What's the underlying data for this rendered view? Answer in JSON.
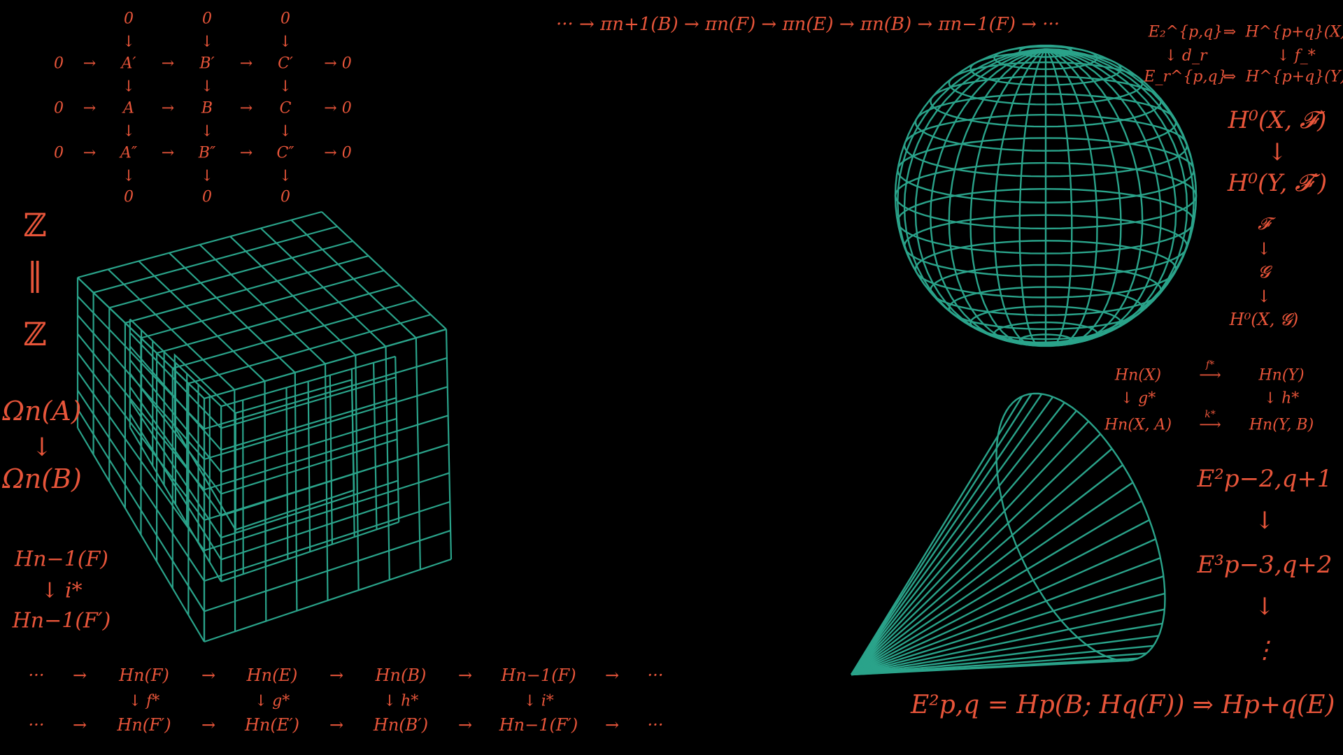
{
  "colors": {
    "background": "#000000",
    "formula": "#e8553a",
    "wireframe": "#2aa38a"
  },
  "nine_lemma": {
    "rows": [
      [
        "",
        "0",
        "",
        "0",
        "",
        "0",
        "",
        ""
      ],
      [
        "0",
        "→",
        "A′",
        "→",
        "B′",
        "→",
        "C′",
        "→ 0"
      ],
      [
        "0",
        "→",
        "A",
        "→",
        "B",
        "→",
        "C",
        "→ 0"
      ],
      [
        "0",
        "→",
        "A″",
        "→",
        "B″",
        "→",
        "C″",
        "→ 0"
      ],
      [
        "",
        "0",
        "",
        "0",
        "",
        "0",
        "",
        ""
      ]
    ],
    "top_zero": "0",
    "bottom_zero": "0",
    "arrow_down": "↓"
  },
  "top_sequence": "⋯ → π_{n+1}(B) → π_n(F) → π_n(E) → π_n(B) → π_{n−1}(F) → ⋯",
  "top_sequence_display": "··· → πn+1(B) → πn(F) → πn(E) → πn(B) → πn−1(F) → ···",
  "spectral_top_right": {
    "row1_left": "E₂^{p,q}",
    "row1_arrow": "⇒",
    "row1_right": "H^{p+q}(X)",
    "row2_left": "↓ d_r",
    "row2_right": "↓ f_*",
    "row3_left": "E_r^{p,q}",
    "row3_arrow": "⇒",
    "row3_right": "H^{p+q}(Y)"
  },
  "sheaf_cohomology": {
    "top": "H⁰(X, 𝓕)",
    "arrow": "↓",
    "bottom": "H⁰(Y, 𝓕′)"
  },
  "sheaf_map": {
    "top": "𝓕",
    "arrow1": "↓",
    "middle": "𝓖",
    "arrow2": "↓",
    "bottom": "H⁰(X, 𝓖)"
  },
  "homology_square": {
    "tl": "Hn(X)",
    "top_arrow": "f*",
    "tr": "Hn(Y)",
    "left_down": "↓ g*",
    "right_down": "↓ h*",
    "bl": "Hn(X, A)",
    "bottom_arrow": "k*",
    "br": "Hn(Y, B)"
  },
  "spectral_column": {
    "e1": "E²p−2,q+1",
    "a1": "↓",
    "e2": "E³p−3,q+2",
    "a2": "↓",
    "dots": "⋮"
  },
  "serre": "E²p,q = Hp(B; Hq(F)) ⇒ Hp+q(E)",
  "z_equality": {
    "top": "ℤ",
    "mid": "‖",
    "bottom": "ℤ"
  },
  "omega": {
    "top": "Ωn(A)",
    "arrow": "↓",
    "bottom": "Ωn(B)"
  },
  "fiber_map": {
    "top": "Hn−1(F)",
    "arrow": "↓ i*",
    "bottom": "Hn−1(F′)"
  },
  "bottom_sequence": {
    "row1": [
      "···",
      "→",
      "Hn(F)",
      "→",
      "Hn(E)",
      "→",
      "Hn(B)",
      "→",
      "Hn−1(F)",
      "→",
      "···"
    ],
    "row2": [
      "",
      "",
      "↓ f*",
      "",
      "↓ g*",
      "",
      "↓ h*",
      "",
      "↓ i*",
      "",
      ""
    ],
    "row3": [
      "···",
      "→",
      "Hn(F′)",
      "→",
      "Hn(E′)",
      "→",
      "Hn(B′)",
      "→",
      "Hn−1(F′)",
      "→",
      "···"
    ]
  },
  "shapes": [
    "cube-wireframe",
    "sphere-wireframe",
    "cone-wireframe"
  ]
}
